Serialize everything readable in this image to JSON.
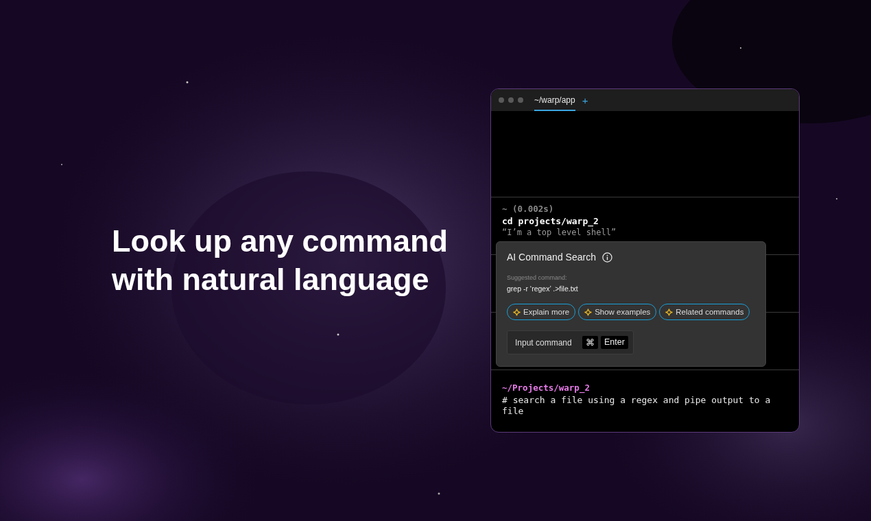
{
  "headline": "Look up any command with natural language",
  "window": {
    "tabs": [
      {
        "label": "~/warp/app",
        "selected": true
      }
    ],
    "new_tab": "+"
  },
  "blocks": [
    {
      "kind": "empty"
    },
    {
      "kind": "output",
      "prompt": "~ (0.002s)",
      "command": "cd projects/warp_2",
      "output": "“I’m a top level shell”"
    },
    {
      "kind": "empty"
    },
    {
      "kind": "empty"
    },
    {
      "kind": "input",
      "prompt": "~/Projects/warp_2",
      "command": "# search a file using a regex and pipe output to a file"
    }
  ],
  "popup": {
    "title": "AI Command Search",
    "suggested_label": "Suggested command:",
    "suggested": "grep -r ‘regex’ .>file.txt",
    "actions": [
      "Explain more",
      "Show examples",
      "Related commands"
    ],
    "input_placeholder": "Input command",
    "keys": [
      "⌘",
      "Enter"
    ]
  }
}
